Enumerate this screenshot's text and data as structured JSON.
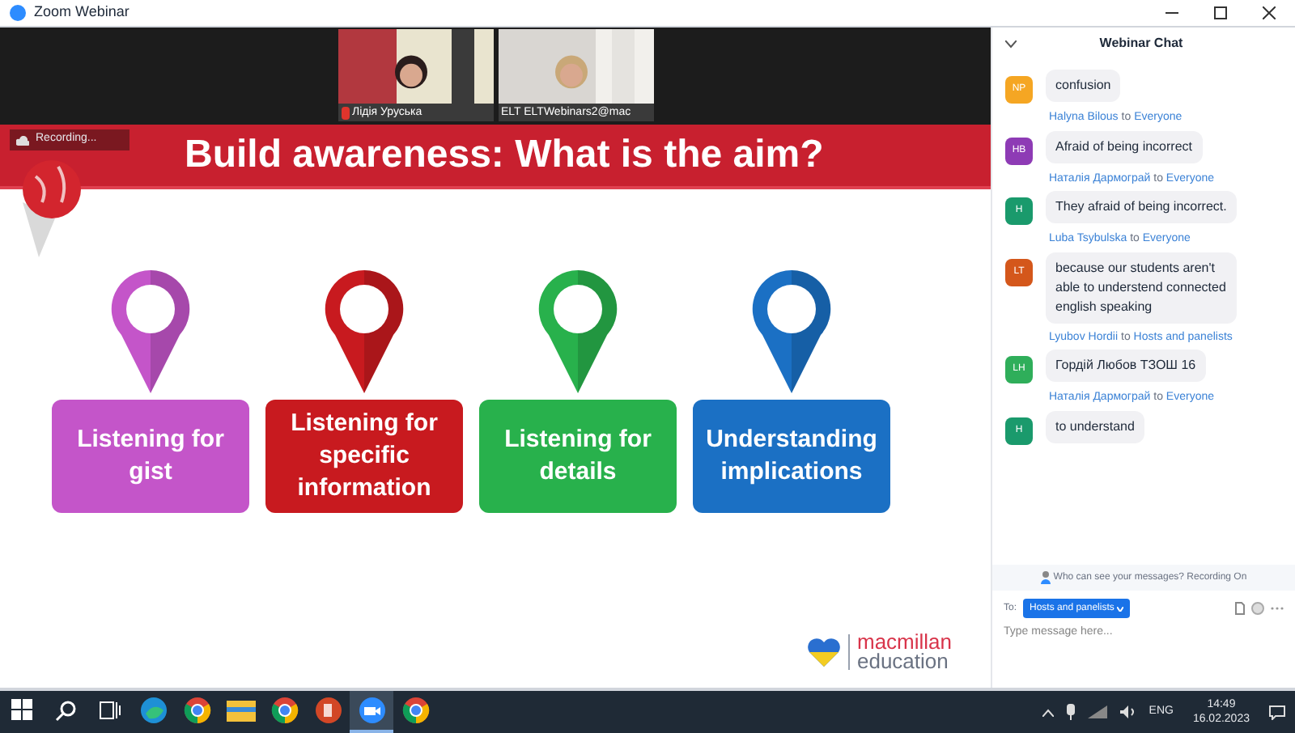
{
  "window": {
    "title": "Zoom Webinar"
  },
  "videos": [
    {
      "name": "Лідія Уруська",
      "muted": true
    },
    {
      "name": "ELT ELTWebinars2@mac",
      "muted": false
    }
  ],
  "recording": {
    "label": "Recording..."
  },
  "slide": {
    "title": "Build awareness: What is the aim?",
    "cards": [
      {
        "label": "Listening for gist",
        "color": "#c455c9"
      },
      {
        "label": "Listening for specific information",
        "color": "#c81a1f"
      },
      {
        "label": "Listening for details",
        "color": "#28b14c"
      },
      {
        "label": "Understanding implications",
        "color": "#1b70c4"
      }
    ],
    "logo": {
      "line_1": "macmillan",
      "line_2": "education"
    }
  },
  "chat": {
    "title": "Webinar Chat",
    "messages": [
      {
        "initials": "NP",
        "color": "#f5a623",
        "text": "confusion"
      },
      {
        "sender": "Halyna Bilous",
        "to": "to",
        "recipient": "Everyone",
        "initials": "HB",
        "color": "#8e3bb5",
        "text": "Afraid of being incorrect"
      },
      {
        "sender": "Наталія Дармограй",
        "to": "to",
        "recipient": "Everyone",
        "initials": "H",
        "color": "#1a9a6c",
        "text": "They afraid of being incorrect."
      },
      {
        "sender": "Luba Tsybulska",
        "to": "to",
        "recipient": "Everyone",
        "initials": "LT",
        "color": "#d4571b",
        "text": "because our students aren't able to understend connected english speaking"
      },
      {
        "sender": "Lyubov Hordii",
        "to": "to",
        "recipient": "Hosts and panelists",
        "initials": "LH",
        "color": "#2fae5a",
        "text": "Гордій Любов ТЗОШ 16"
      },
      {
        "sender": "Наталія Дармограй",
        "to": "to",
        "recipient": "Everyone",
        "initials": "H",
        "color": "#1a9a6c",
        "text": "to understand"
      }
    ],
    "notice": "Who can see your messages? Recording On",
    "to_label": "To:",
    "recipient": "Hosts and panelists",
    "placeholder": "Type message here..."
  },
  "taskbar": {
    "apps": [
      {
        "kind": "start",
        "selected": false
      },
      {
        "kind": "search",
        "selected": false
      },
      {
        "kind": "taskview",
        "selected": false
      },
      {
        "kind": "edge",
        "selected": false
      },
      {
        "kind": "chrome",
        "selected": false
      },
      {
        "kind": "folder",
        "selected": false
      },
      {
        "kind": "chrome",
        "selected": false
      },
      {
        "kind": "powerpoint",
        "selected": false
      },
      {
        "kind": "zoom",
        "selected": true
      },
      {
        "kind": "chrome",
        "selected": false
      }
    ],
    "language": "ENG",
    "time": "14:49",
    "date": "16.02.2023"
  }
}
